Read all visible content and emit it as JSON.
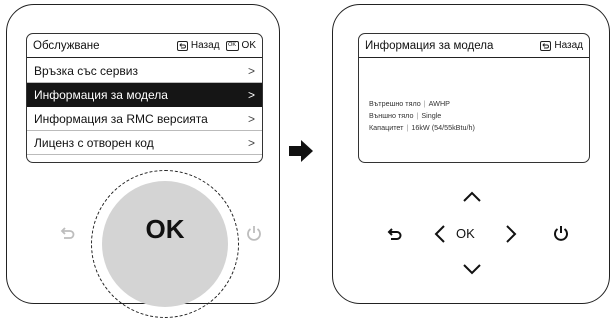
{
  "left_panel": {
    "title": "Обслужване",
    "back_label": "Назад",
    "back_icon": "return-icon",
    "ok_label": "OK",
    "ok_icon_text": "OK",
    "menu_items": [
      {
        "label": "Връзка със сервиз",
        "selected": false
      },
      {
        "label": "Информация за модела",
        "selected": true
      },
      {
        "label": "Информация за RMC версията",
        "selected": false
      },
      {
        "label": "Лиценз с отворен код",
        "selected": false
      }
    ],
    "knob_label": "OK"
  },
  "right_panel": {
    "title": "Информация за модела",
    "back_label": "Назад",
    "info_rows": [
      {
        "key": "Вътрешно тяло",
        "value": "AWHP"
      },
      {
        "key": "Външно тяло",
        "value": "Single"
      },
      {
        "key": "Капацитет",
        "value": "16kW (54/55kBtu/h)"
      }
    ],
    "nav_ok_label": "OK"
  },
  "colors": {
    "selected_row_bg": "#151515",
    "knob_fill": "#d4d4d4",
    "outline": "#222222"
  }
}
